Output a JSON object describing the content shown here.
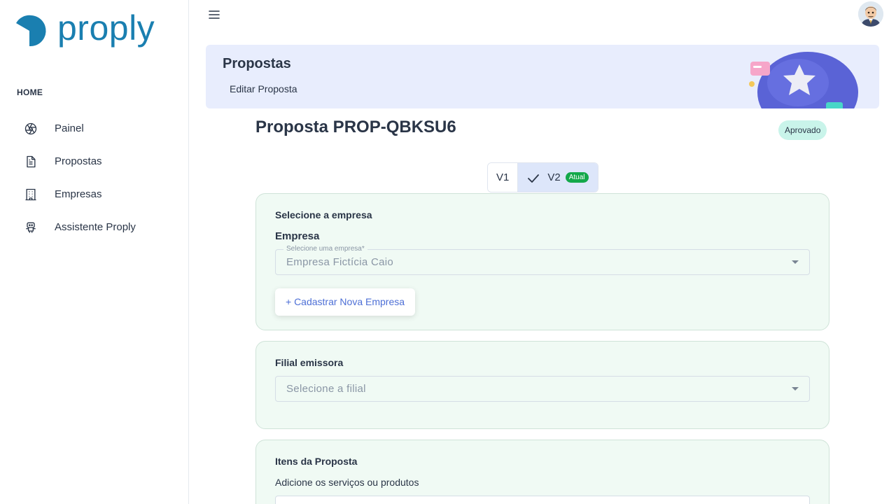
{
  "brand": {
    "name": "proply"
  },
  "sidebar": {
    "caption": "HOME",
    "items": [
      {
        "label": "Painel",
        "icon": "aperture-icon"
      },
      {
        "label": "Propostas",
        "icon": "file-text-icon"
      },
      {
        "label": "Empresas",
        "icon": "building-icon"
      },
      {
        "label": "Assistente Proply",
        "icon": "robot-icon"
      }
    ]
  },
  "banner": {
    "title": "Propostas",
    "breadcrumb": "Editar Proposta"
  },
  "page": {
    "title": "Proposta PROP-QBKSU6",
    "status": "Aprovado"
  },
  "versions": {
    "v1": "V1",
    "v2": "V2",
    "current_badge": "Atual"
  },
  "empresa_card": {
    "title": "Selecione a empresa",
    "field_label": "Empresa",
    "select_label": "Selecione uma empresa*",
    "select_value": "Empresa Fictícia Caio",
    "add_button": "+ Cadastrar Nova Empresa"
  },
  "filial_card": {
    "title": "Filial emissora",
    "placeholder": "Selecione a filial"
  },
  "itens_card": {
    "title": "Itens da Proposta",
    "subtitle": "Adicione os serviços ou produtos"
  },
  "colors": {
    "brand": "#1a7fb0",
    "status_bg": "#c9f4ea",
    "current_badge": "#13a84a",
    "card_bg": "#f0faf4",
    "link": "#4d6fd6"
  }
}
